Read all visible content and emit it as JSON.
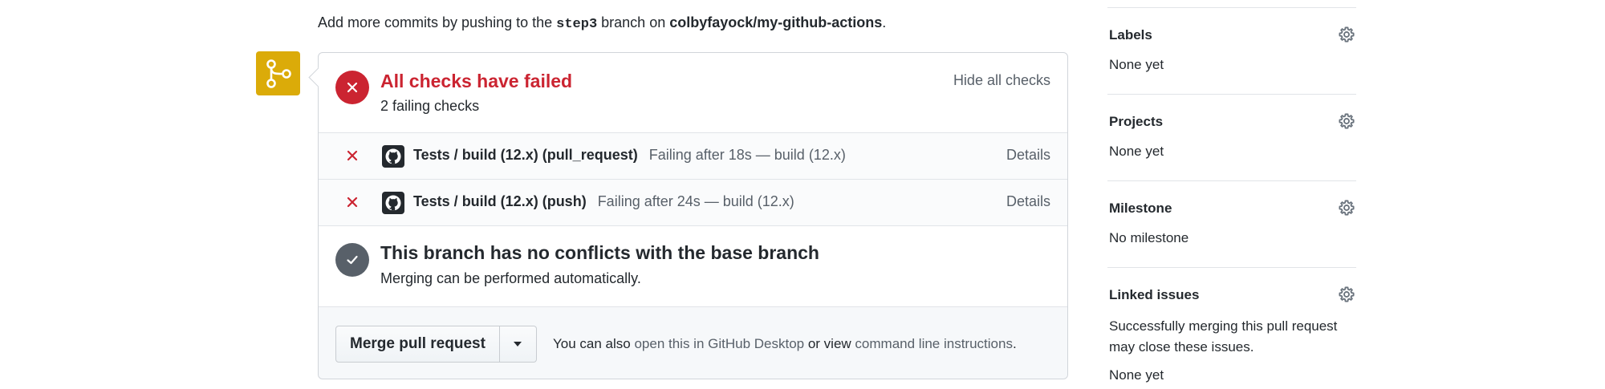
{
  "hint": {
    "prefix": "Add more commits by pushing to the ",
    "branch": "step3",
    "middle": " branch on ",
    "repo": "colbyfayock/my-github-actions",
    "suffix": "."
  },
  "status": {
    "title": "All checks have failed",
    "subtitle": "2 failing checks",
    "toggle_label": "Hide all checks"
  },
  "checks": [
    {
      "name": "Tests / build (12.x) (pull_request)",
      "description": "Failing after 18s — build (12.x)",
      "link": "Details"
    },
    {
      "name": "Tests / build (12.x) (push)",
      "description": "Failing after 24s — build (12.x)",
      "link": "Details"
    }
  ],
  "conflicts": {
    "title": "This branch has no conflicts with the base branch",
    "subtitle": "Merging can be performed automatically."
  },
  "merge": {
    "button_label": "Merge pull request",
    "note_prefix": "You can also ",
    "desktop_link": "open this in GitHub Desktop",
    "note_middle": " or view ",
    "cli_link": "command line instructions",
    "note_suffix": "."
  },
  "sidebar": {
    "sections": [
      {
        "title": "Labels",
        "body": "None yet"
      },
      {
        "title": "Projects",
        "body": "None yet"
      },
      {
        "title": "Milestone",
        "body": "No milestone"
      },
      {
        "title": "Linked issues",
        "body": "Successfully merging this pull request may close these issues.",
        "extra": "None yet"
      }
    ]
  },
  "colors": {
    "fail": "#cb2431",
    "merge_icon_bg": "#dbab09",
    "neutral_icon": "#586069"
  },
  "icons": {
    "merge": "git-branch-icon",
    "fail": "x-icon",
    "success": "check-icon",
    "app": "github-logo-icon",
    "settings": "gear-icon",
    "dropdown": "caret-down-icon"
  }
}
